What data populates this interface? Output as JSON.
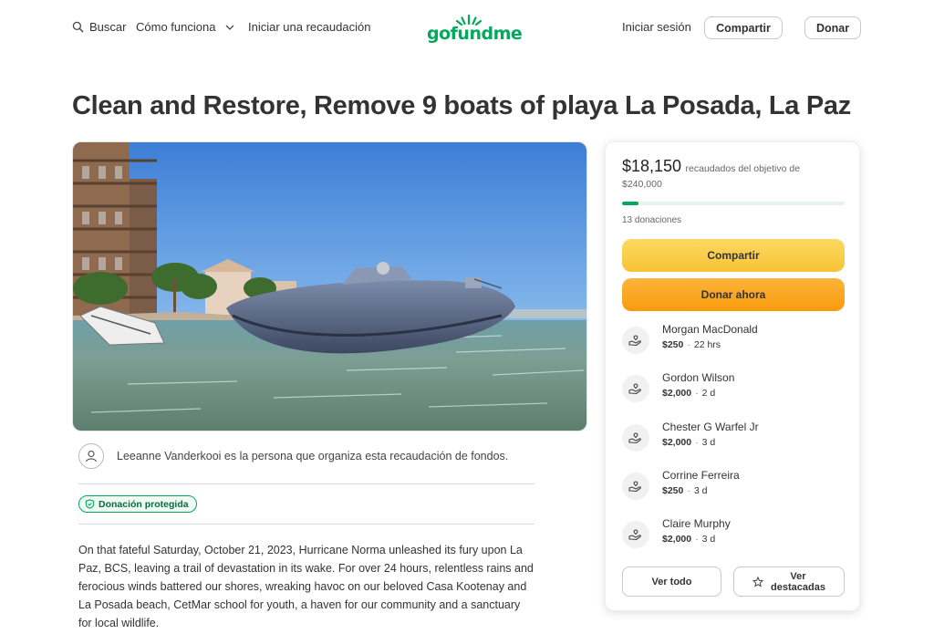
{
  "header": {
    "search_label": "Buscar",
    "how_it_works_label": "Cómo funciona",
    "start_label": "Iniciar una recaudación",
    "logo_text": "gofundme",
    "login_label": "Iniciar sesión",
    "share_label": "Compartir",
    "donate_label": "Donar"
  },
  "campaign": {
    "title": "Clean and Restore, Remove 9 boats of playa La Posada, La Paz",
    "organizer_text": "Leeanne Vanderkooi es la persona que organiza esta recaudación de fondos.",
    "protected_label": "Donación protegida",
    "story": "On that fateful Saturday, October 21, 2023, Hurricane Norma unleashed its fury upon La Paz, BCS, leaving a trail of devastation in its wake. For over 24 hours, relentless rains and ferocious winds battered our shores, wreaking havoc on our beloved Casa Kootenay and La Posada beach, CetMar school for youth, a haven for our community and a sanctuary for local wildlife."
  },
  "card": {
    "raised_amount": "$18,150",
    "raised_of": "recaudados del objetivo de",
    "goal": "$240,000",
    "progress_fraction": 0.0756,
    "donations_count": "13 donaciones",
    "share_label": "Compartir",
    "donate_now_label": "Donar ahora",
    "donors": [
      {
        "name": "Morgan MacDonald",
        "amount": "$250",
        "time": "22 hrs"
      },
      {
        "name": "Gordon Wilson",
        "amount": "$2,000",
        "time": "2 d"
      },
      {
        "name": "Chester G Warfel Jr",
        "amount": "$2,000",
        "time": "3 d"
      },
      {
        "name": "Corrine Ferreira",
        "amount": "$250",
        "time": "3 d"
      },
      {
        "name": "Claire Murphy",
        "amount": "$2,000",
        "time": "3 d"
      }
    ],
    "see_all_label": "Ver todo",
    "see_top_label_line1": "Ver",
    "see_top_label_line2": "destacadas"
  },
  "colors": {
    "brand_green": "#02a95c",
    "share_yellow": "#f7c336",
    "donate_orange": "#f89b0d"
  },
  "icons": [
    "search-icon",
    "chevron-down-icon",
    "gofundme-sprout-icon",
    "user-icon",
    "shield-icon",
    "donation-hand-icon",
    "star-icon"
  ]
}
